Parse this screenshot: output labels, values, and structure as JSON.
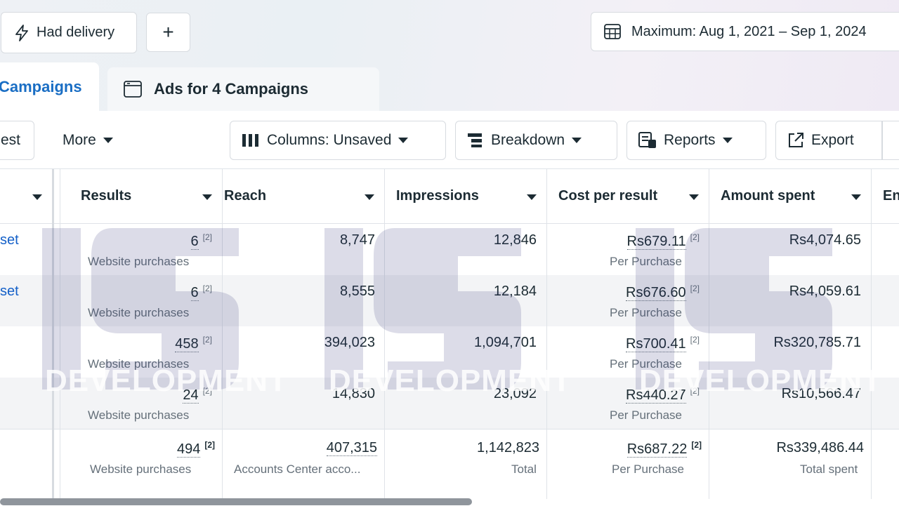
{
  "filters": {
    "had_delivery_label": "Had delivery",
    "add_label": "+",
    "date_range_label": "Maximum: Aug 1, 2021 – Sep 1, 2024"
  },
  "tabs": [
    {
      "label": "Campaigns",
      "active": true
    },
    {
      "label": "Ads for 4 Campaigns",
      "active": false
    }
  ],
  "toolbar": {
    "test_label": "est",
    "more_label": "More",
    "columns_label": "Columns: Unsaved",
    "breakdown_label": "Breakdown",
    "reports_label": "Reports",
    "export_label": "Export"
  },
  "table": {
    "headers": [
      "Results",
      "Reach",
      "Impressions",
      "Cost per result",
      "Amount spent",
      "En"
    ],
    "rows": [
      {
        "name": "set",
        "results": "6",
        "results_sup": "[2]",
        "results_sub": "Website purchases",
        "reach": "8,747",
        "impressions": "12,846",
        "cpr": "Rs679.11",
        "cpr_sup": "[2]",
        "cpr_sub": "Per Purchase",
        "spent": "Rs4,074.65"
      },
      {
        "name": "set",
        "results": "6",
        "results_sup": "[2]",
        "results_sub": "Website purchases",
        "reach": "8,555",
        "impressions": "12,184",
        "cpr": "Rs676.60",
        "cpr_sup": "[2]",
        "cpr_sub": "Per Purchase",
        "spent": "Rs4,059.61"
      },
      {
        "name": "",
        "results": "458",
        "results_sup": "[2]",
        "results_sub": "Website purchases",
        "reach": "394,023",
        "impressions": "1,094,701",
        "cpr": "Rs700.41",
        "cpr_sup": "[2]",
        "cpr_sub": "Per Purchase",
        "spent": "Rs320,785.71"
      },
      {
        "name": "",
        "results": "24",
        "results_sup": "[2]",
        "results_sub": "Website purchases",
        "reach": "14,830",
        "impressions": "23,092",
        "cpr": "Rs440.27",
        "cpr_sup": "[2]",
        "cpr_sub": "Per Purchase",
        "spent": "Rs10,566.47"
      }
    ],
    "total": {
      "results": "494",
      "results_sup": "[2]",
      "results_sub": "Website purchases",
      "reach": "407,315",
      "reach_sub": "Accounts Center acco...",
      "impressions": "1,142,823",
      "impressions_sub": "Total",
      "cpr": "Rs687.22",
      "cpr_sup": "[2]",
      "cpr_sub": "Per Purchase",
      "spent": "Rs339,486.44",
      "spent_sub": "Total spent"
    }
  },
  "watermark": {
    "text": "DEVELOPMENT"
  },
  "colors": {
    "accent": "#1460c8",
    "brand_watermark": "#2b2f73"
  }
}
